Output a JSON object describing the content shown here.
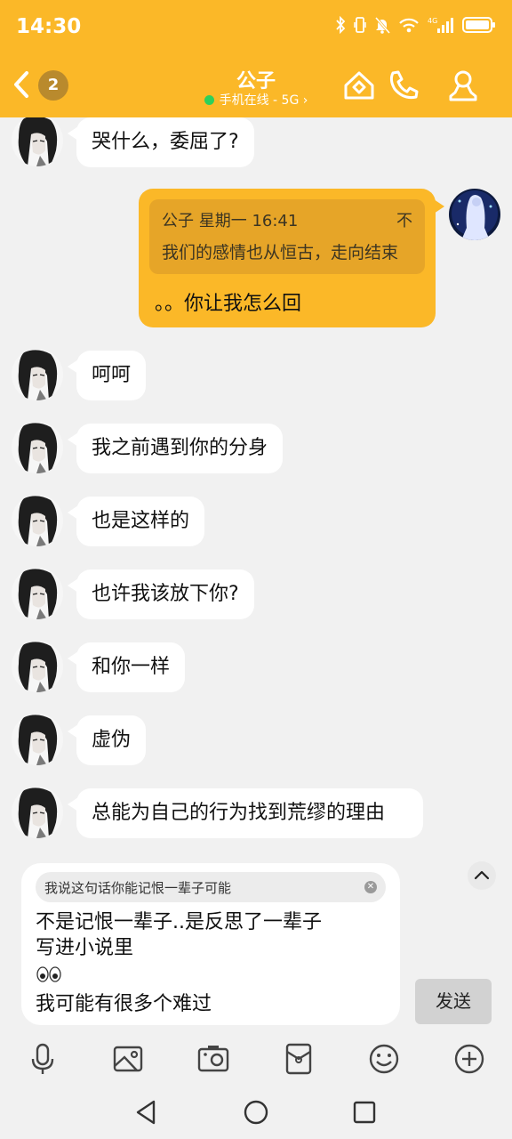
{
  "status_bar": {
    "time": "14:30",
    "network_label": "4G",
    "icons": [
      "bluetooth-icon",
      "vibrate-icon",
      "mute-icon",
      "wifi-icon",
      "signal-icon",
      "battery-icon"
    ]
  },
  "header": {
    "contact_name": "公子",
    "online_status": "手机在线 - 5G ›",
    "unread_count": "2",
    "icons": [
      "back-icon",
      "home-icon",
      "phone-icon",
      "profile-icon"
    ],
    "accent_color": "#fbb828"
  },
  "messages": [
    {
      "side": "in",
      "text": "哭什么，委屈了?"
    },
    {
      "side": "out",
      "quote": {
        "author_time": "公子 星期一 16:41",
        "collapse": "不",
        "text": "我们的感情也从恒古，走向结束"
      },
      "text": "。。你让我怎么回"
    },
    {
      "side": "in",
      "text": "呵呵"
    },
    {
      "side": "in",
      "text": "我之前遇到你的分身"
    },
    {
      "side": "in",
      "text": "也是这样的"
    },
    {
      "side": "in",
      "text": "也许我该放下你?"
    },
    {
      "side": "in",
      "text": "和你一样"
    },
    {
      "side": "in",
      "text": "虚伪"
    },
    {
      "side": "in",
      "text": "总能为自己的行为找到荒缪的理由"
    }
  ],
  "composer": {
    "reply_to": "我说这句话你能记恨一辈子可能",
    "draft_lines": [
      "不是记恨一辈子..是反思了一辈子",
      "写进小说里"
    ],
    "draft_emoji": "👀",
    "draft_last_line": "我可能有很多个难过",
    "send_label": "发送"
  },
  "toolbar": {
    "icons": [
      "microphone-icon",
      "image-icon",
      "camera-icon",
      "red-packet-icon",
      "emoji-icon",
      "plus-icon"
    ]
  },
  "system_nav": {
    "icons": [
      "nav-back-icon",
      "nav-home-icon",
      "nav-recents-icon"
    ]
  }
}
